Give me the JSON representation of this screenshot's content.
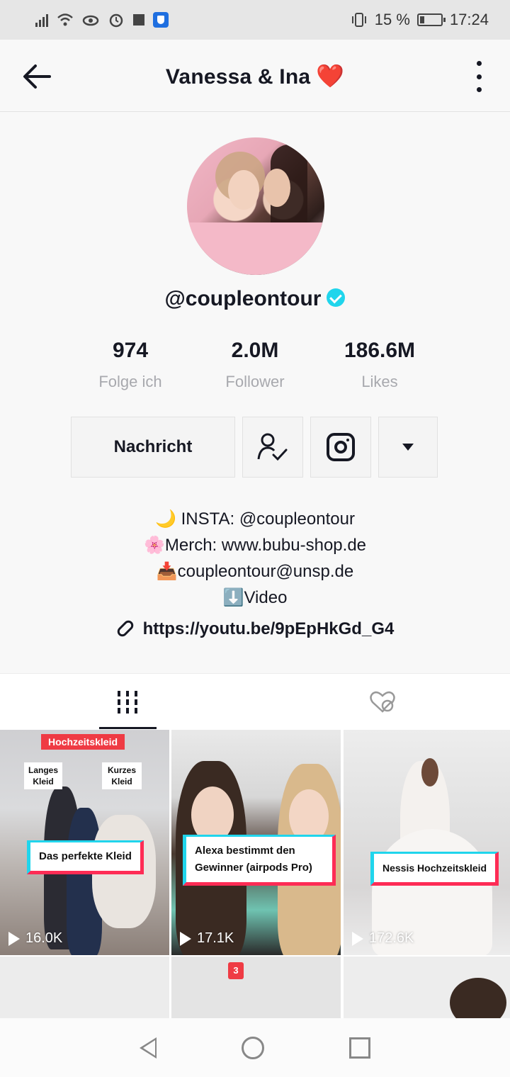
{
  "status_bar": {
    "battery_percent": "15 %",
    "time": "17:24"
  },
  "header": {
    "title": "Vanessa & Ina",
    "title_emoji": "❤️",
    "back_icon": "arrow-left-icon",
    "menu_icon": "kebab-menu-icon"
  },
  "profile": {
    "username": "@coupleontour",
    "verified": true,
    "stats": [
      {
        "value": "974",
        "label": "Folge ich"
      },
      {
        "value": "2.0M",
        "label": "Follower"
      },
      {
        "value": "186.6M",
        "label": "Likes"
      }
    ],
    "buttons": {
      "message": "Nachricht"
    },
    "bio": [
      "🌙 INSTA: @coupleontour",
      "🌸Merch: www.bubu-shop.de",
      "📥coupleontour@unsp.de",
      "⬇️Video"
    ],
    "link": "https://youtu.be/9pEpHkGd_G4"
  },
  "tabs": [
    {
      "name": "videos",
      "icon": "grid-icon",
      "active": true
    },
    {
      "name": "liked",
      "icon": "hidden-heart-icon",
      "active": false
    }
  ],
  "videos": [
    {
      "red_tag": "Hochzeitskleid",
      "tags": [
        "Langes Kleid",
        "Kurzes Kleid"
      ],
      "caption": "Das perfekte Kleid",
      "views": "16.0K"
    },
    {
      "caption_line1": "Alexa bestimmt den",
      "caption_line2": "Gewinner (airpods Pro)",
      "views": "17.1K"
    },
    {
      "caption": "Nessis Hochzeitskleid",
      "views": "172.6K"
    },
    {
      "badge": ""
    },
    {
      "badge": "3"
    },
    {
      "badge": ""
    }
  ],
  "colors": {
    "accent_cyan": "#20d5ec",
    "accent_red": "#fe2c55",
    "verified": "#20d5ec",
    "heart": "#e02a3d"
  }
}
